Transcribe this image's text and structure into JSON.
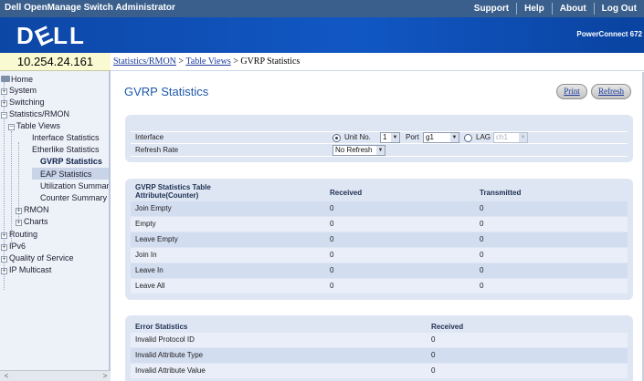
{
  "topbar": {
    "title": "Dell OpenManage Switch Administrator",
    "links": [
      "Support",
      "Help",
      "About",
      "Log Out"
    ]
  },
  "brand": {
    "logo": "DELL",
    "product": "PowerConnect 672"
  },
  "ip_address": "10.254.24.161",
  "breadcrumb": {
    "item1": "Statistics/RMON",
    "sep1": " > ",
    "item2": "Table Views",
    "sep2": " > ",
    "current": "GVRP Statistics"
  },
  "sidebar": {
    "home": "Home",
    "system": "System",
    "switching": "Switching",
    "statistics": "Statistics/RMON",
    "table_views": "Table Views",
    "interface_statistics": "Interface Statistics",
    "etherlike_statistics": "Etherlike Statistics",
    "gvrp_statistics": "GVRP Statistics",
    "eap_statistics": "EAP Statistics",
    "utilization_summary": "Utilization Summary",
    "counter_summary": "Counter Summary",
    "rmon": "RMON",
    "charts": "Charts",
    "routing": "Routing",
    "ipv6": "IPv6",
    "qos": "Quality of Service",
    "ip_multicast": "IP Multicast",
    "expand_glyph": "+",
    "collapse_glyph": "−"
  },
  "page": {
    "title": "GVRP Statistics",
    "print_label": "Print",
    "refresh_label": "Refresh"
  },
  "settings": {
    "interface_label": "Interface",
    "unit_label": "Unit No.",
    "unit_value": "1",
    "port_label": "Port",
    "port_value": "g1",
    "lag_label": "LAG",
    "lag_value": "ch1",
    "refresh_rate_label": "Refresh Rate",
    "refresh_rate_value": "No Refresh",
    "caret": "▼"
  },
  "gvrp_table": {
    "header_line1": "GVRP Statistics Table",
    "header_line2": "Attribute(Counter)",
    "col_received": "Received",
    "col_transmitted": "Transmitted",
    "rows": [
      {
        "attribute": "Join Empty",
        "received": "0",
        "transmitted": "0"
      },
      {
        "attribute": "Empty",
        "received": "0",
        "transmitted": "0"
      },
      {
        "attribute": "Leave Empty",
        "received": "0",
        "transmitted": "0"
      },
      {
        "attribute": "Join In",
        "received": "0",
        "transmitted": "0"
      },
      {
        "attribute": "Leave In",
        "received": "0",
        "transmitted": "0"
      },
      {
        "attribute": "Leave All",
        "received": "0",
        "transmitted": "0"
      }
    ]
  },
  "error_table": {
    "header": "Error Statistics",
    "col_received": "Received",
    "rows": [
      {
        "label": "Invalid Protocol ID",
        "received": "0"
      },
      {
        "label": "Invalid Attribute Type",
        "received": "0"
      },
      {
        "label": "Invalid Attribute Value",
        "received": "0"
      }
    ]
  },
  "scroll_arrows": {
    "left": "<",
    "right": ">"
  },
  "colors": {
    "topbar": "#3a5f8c",
    "brand_blue": "#1157c4",
    "title_blue": "#1d58a8",
    "panel_bg": "#dfe6f3",
    "sidebar_bg": "#edf1f8",
    "ip_bg": "#fafad2"
  }
}
